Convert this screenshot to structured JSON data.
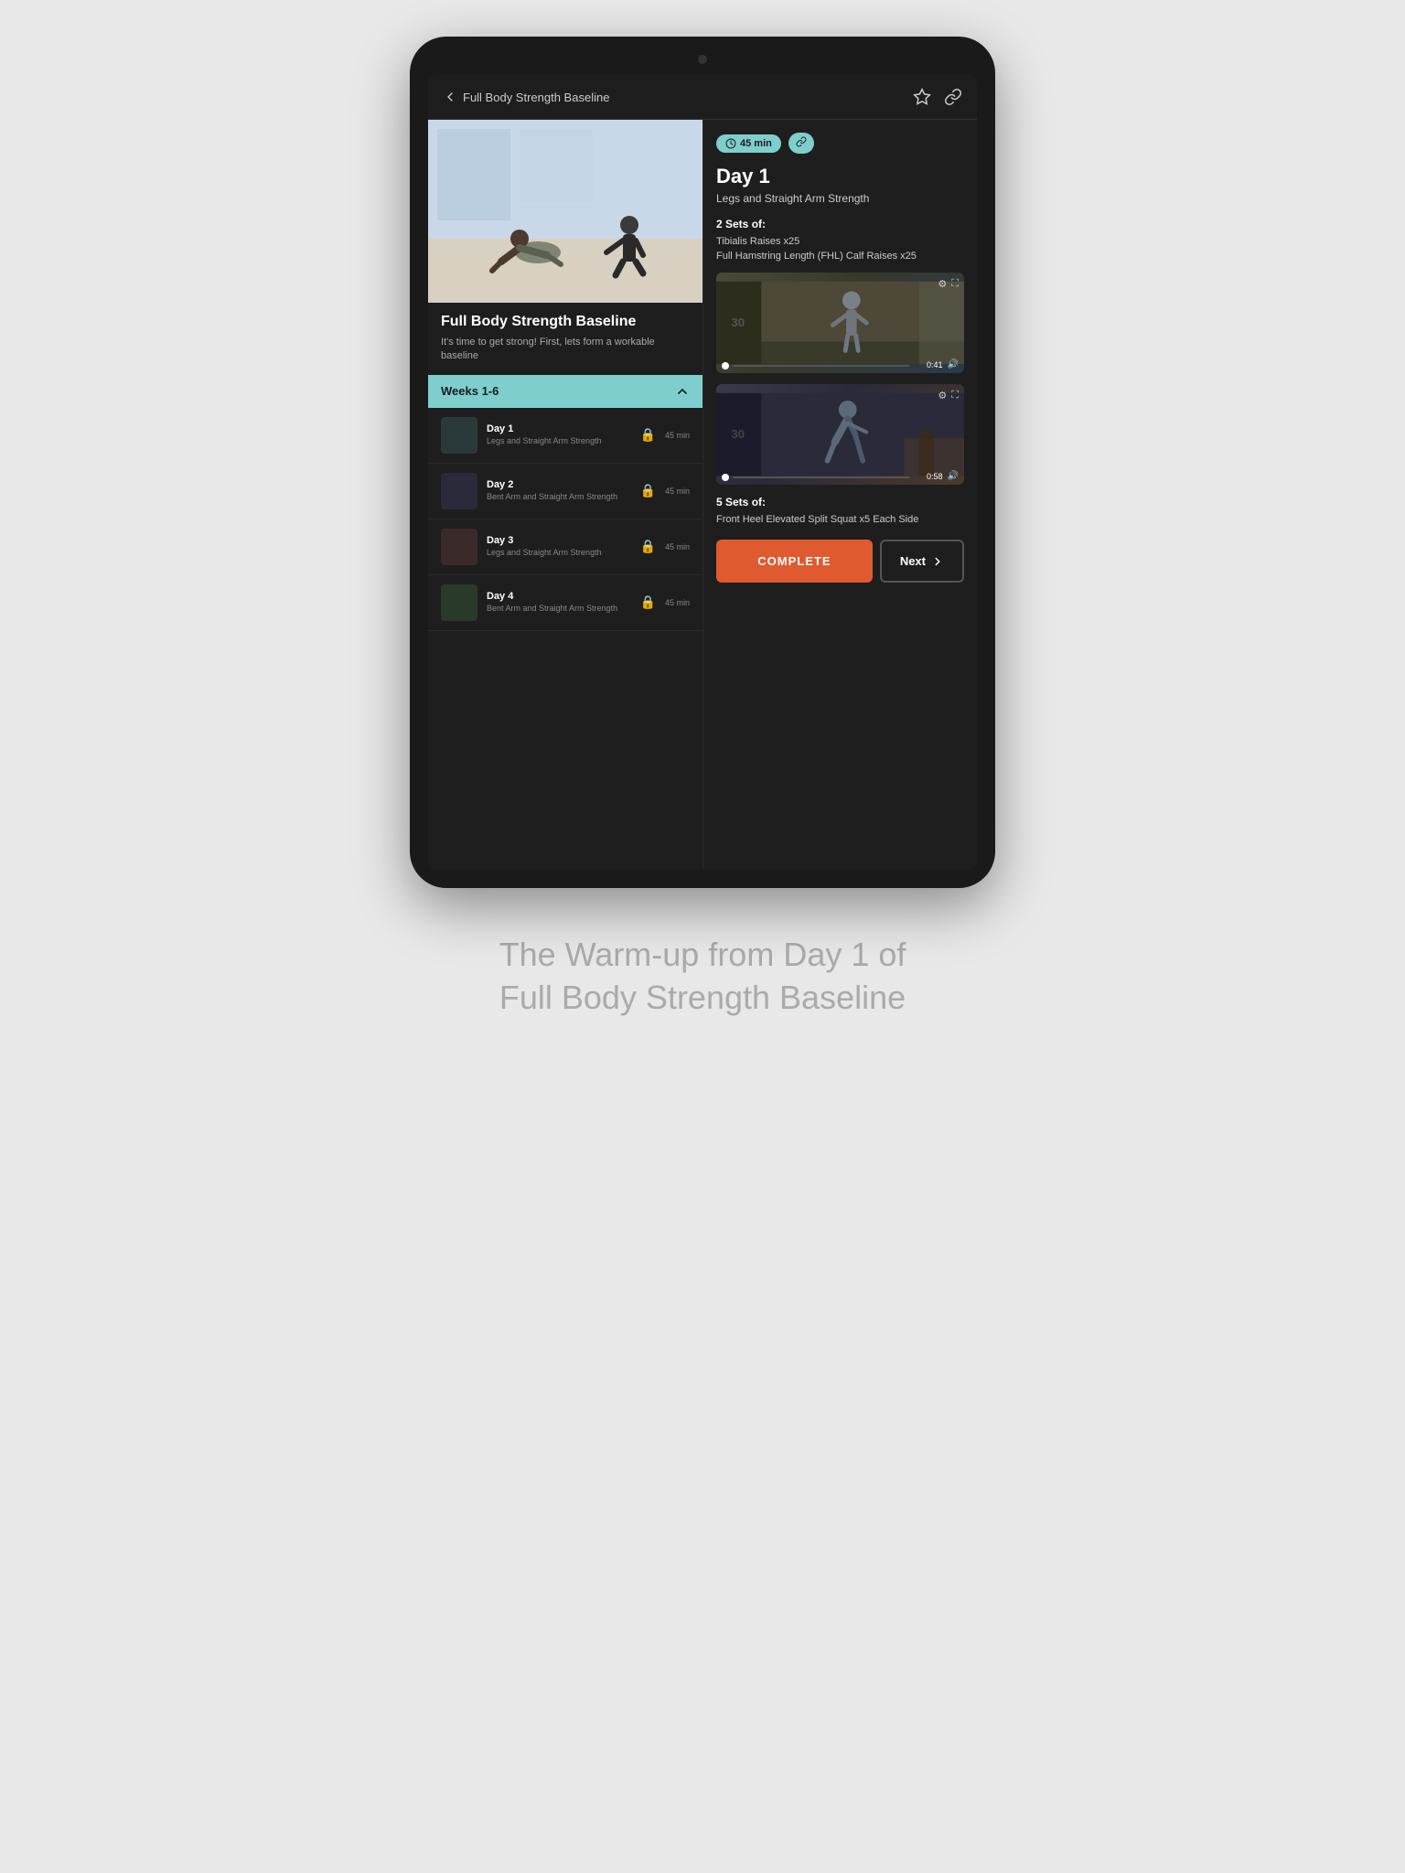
{
  "page": {
    "background_color": "#e8e8e8",
    "caption": "The Warm-up from Day 1 of\nFull Body Strength Baseline"
  },
  "header": {
    "back_label": "Full Body Strength Baseline",
    "star_icon": "star",
    "link_icon": "link"
  },
  "program": {
    "title": "Full Body Strength Baseline",
    "description": "It's time to get strong! First, lets form a workable baseline"
  },
  "weeks_section": {
    "label": "Weeks 1-6",
    "collapsed": false
  },
  "days": [
    {
      "name": "Day 1",
      "subtitle": "Legs and Straight Arm Strength",
      "locked": true,
      "duration": "45 min"
    },
    {
      "name": "Day 2",
      "subtitle": "Bent Arm and Straight Arm Strength",
      "locked": true,
      "duration": "45 min"
    },
    {
      "name": "Day 3",
      "subtitle": "Legs and Straight Arm Strength",
      "locked": true,
      "duration": "45 min"
    },
    {
      "name": "Day 4",
      "subtitle": "Bent Arm and Straight Arm Strength",
      "locked": true,
      "duration": "45 min"
    }
  ],
  "workout": {
    "duration": "45 min",
    "title": "Day 1",
    "subtitle": "Legs and Straight Arm Strength",
    "sets_label_1": "2 Sets of:",
    "exercises_1": [
      "Tibialis Raises x25",
      "Full Hamstring Length (FHL) Calf Raises x25"
    ],
    "video_1": {
      "duration": "0:41",
      "progress": "0"
    },
    "video_2": {
      "duration": "0:58",
      "progress": "0"
    },
    "sets_label_2": "5 Sets of:",
    "exercises_2": [
      "Front Heel Elevated Split Squat x5 Each Side"
    ]
  },
  "buttons": {
    "complete_label": "COMPLETE",
    "next_label": "Next"
  }
}
